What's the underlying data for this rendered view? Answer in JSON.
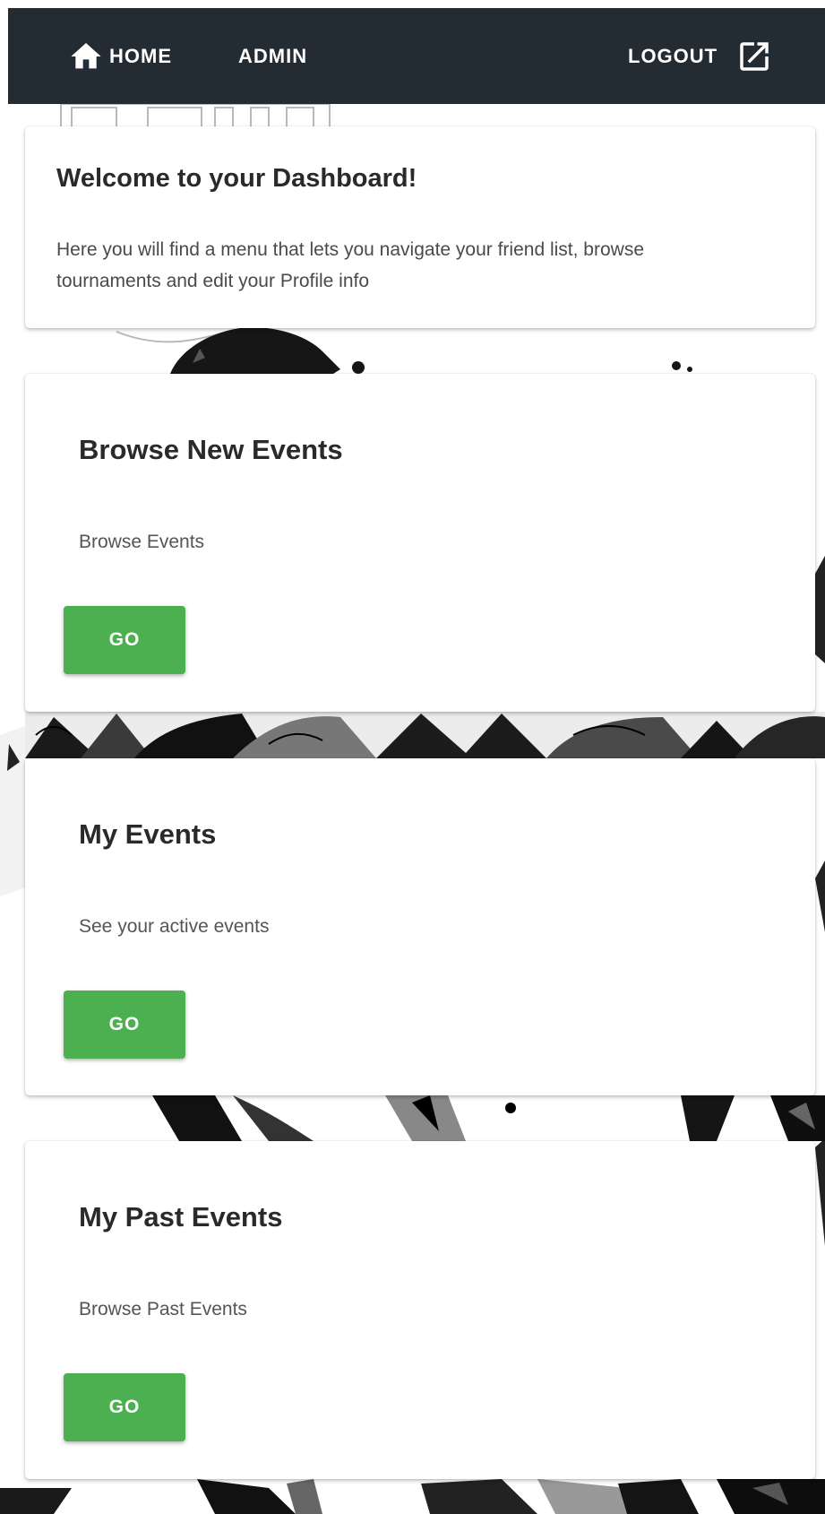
{
  "nav": {
    "home_label": "HOME",
    "admin_label": "ADMIN",
    "logout_label": "LOGOUT"
  },
  "welcome": {
    "title": "Welcome to your Dashboard!",
    "text": "Here you will find a menu that lets you navigate your friend list, browse tournaments and edit your Profile info"
  },
  "cards": [
    {
      "title": "Browse New Events",
      "subtitle": "Browse Events",
      "button_label": "GO"
    },
    {
      "title": "My Events",
      "subtitle": "See your active events",
      "button_label": "GO"
    },
    {
      "title": "My Past Events",
      "subtitle": "Browse Past Events",
      "button_label": "GO"
    }
  ],
  "colors": {
    "navbar_bg": "#232b33",
    "button_green": "#4caf50",
    "card_bg": "#ffffff"
  },
  "icons": {
    "home": "home-icon",
    "logout": "external-link-icon"
  }
}
